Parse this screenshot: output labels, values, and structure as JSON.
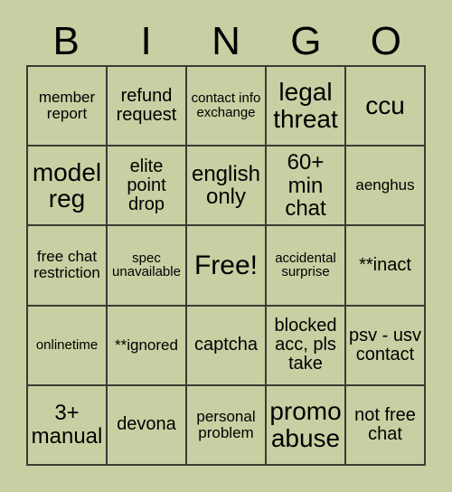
{
  "card": {
    "title_letters": [
      "B",
      "I",
      "N",
      "G",
      "O"
    ],
    "background_color": "#c8d0a3",
    "border_color": "#3b3b33",
    "text_color": "#000000",
    "rows": 5,
    "columns": 5,
    "cells": [
      [
        {
          "text": "member report",
          "size": "md"
        },
        {
          "text": "refund request",
          "size": "lg"
        },
        {
          "text": "contact info exchange",
          "size": "sm"
        },
        {
          "text": "legal threat",
          "size": "xxl"
        },
        {
          "text": "ccu",
          "size": "xxl"
        }
      ],
      [
        {
          "text": "model reg",
          "size": "xxl"
        },
        {
          "text": "elite point drop",
          "size": "lg"
        },
        {
          "text": "english only",
          "size": "xl"
        },
        {
          "text": "60+ min chat",
          "size": "xl"
        },
        {
          "text": "aenghus",
          "size": "md"
        }
      ],
      [
        {
          "text": "free chat restriction",
          "size": "md"
        },
        {
          "text": "spec unavailable",
          "size": "sm"
        },
        {
          "text": "Free!",
          "size": "free"
        },
        {
          "text": "accidental surprise",
          "size": "sm"
        },
        {
          "text": "**inact",
          "size": "lg"
        }
      ],
      [
        {
          "text": "onlinetime",
          "size": "sm"
        },
        {
          "text": "**ignored",
          "size": "md"
        },
        {
          "text": "captcha",
          "size": "lg"
        },
        {
          "text": "blocked acc, pls take",
          "size": "lg"
        },
        {
          "text": "psv - usv contact",
          "size": "lg"
        }
      ],
      [
        {
          "text": "3+ manual",
          "size": "xl"
        },
        {
          "text": "devona",
          "size": "lg"
        },
        {
          "text": "personal problem",
          "size": "md"
        },
        {
          "text": "promo abuse",
          "size": "xxl"
        },
        {
          "text": "not free chat",
          "size": "lg"
        }
      ]
    ]
  }
}
